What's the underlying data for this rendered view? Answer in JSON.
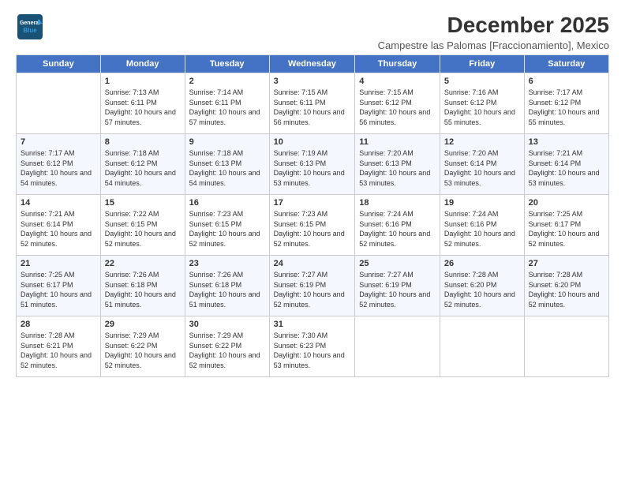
{
  "logo": {
    "line1": "General",
    "line2": "Blue"
  },
  "title": "December 2025",
  "location": "Campestre las Palomas [Fraccionamiento], Mexico",
  "days_of_week": [
    "Sunday",
    "Monday",
    "Tuesday",
    "Wednesday",
    "Thursday",
    "Friday",
    "Saturday"
  ],
  "weeks": [
    [
      {
        "day": "",
        "sunrise": "",
        "sunset": "",
        "daylight": ""
      },
      {
        "day": "1",
        "sunrise": "Sunrise: 7:13 AM",
        "sunset": "Sunset: 6:11 PM",
        "daylight": "Daylight: 10 hours and 57 minutes."
      },
      {
        "day": "2",
        "sunrise": "Sunrise: 7:14 AM",
        "sunset": "Sunset: 6:11 PM",
        "daylight": "Daylight: 10 hours and 57 minutes."
      },
      {
        "day": "3",
        "sunrise": "Sunrise: 7:15 AM",
        "sunset": "Sunset: 6:11 PM",
        "daylight": "Daylight: 10 hours and 56 minutes."
      },
      {
        "day": "4",
        "sunrise": "Sunrise: 7:15 AM",
        "sunset": "Sunset: 6:12 PM",
        "daylight": "Daylight: 10 hours and 56 minutes."
      },
      {
        "day": "5",
        "sunrise": "Sunrise: 7:16 AM",
        "sunset": "Sunset: 6:12 PM",
        "daylight": "Daylight: 10 hours and 55 minutes."
      },
      {
        "day": "6",
        "sunrise": "Sunrise: 7:17 AM",
        "sunset": "Sunset: 6:12 PM",
        "daylight": "Daylight: 10 hours and 55 minutes."
      }
    ],
    [
      {
        "day": "7",
        "sunrise": "Sunrise: 7:17 AM",
        "sunset": "Sunset: 6:12 PM",
        "daylight": "Daylight: 10 hours and 54 minutes."
      },
      {
        "day": "8",
        "sunrise": "Sunrise: 7:18 AM",
        "sunset": "Sunset: 6:12 PM",
        "daylight": "Daylight: 10 hours and 54 minutes."
      },
      {
        "day": "9",
        "sunrise": "Sunrise: 7:18 AM",
        "sunset": "Sunset: 6:13 PM",
        "daylight": "Daylight: 10 hours and 54 minutes."
      },
      {
        "day": "10",
        "sunrise": "Sunrise: 7:19 AM",
        "sunset": "Sunset: 6:13 PM",
        "daylight": "Daylight: 10 hours and 53 minutes."
      },
      {
        "day": "11",
        "sunrise": "Sunrise: 7:20 AM",
        "sunset": "Sunset: 6:13 PM",
        "daylight": "Daylight: 10 hours and 53 minutes."
      },
      {
        "day": "12",
        "sunrise": "Sunrise: 7:20 AM",
        "sunset": "Sunset: 6:14 PM",
        "daylight": "Daylight: 10 hours and 53 minutes."
      },
      {
        "day": "13",
        "sunrise": "Sunrise: 7:21 AM",
        "sunset": "Sunset: 6:14 PM",
        "daylight": "Daylight: 10 hours and 53 minutes."
      }
    ],
    [
      {
        "day": "14",
        "sunrise": "Sunrise: 7:21 AM",
        "sunset": "Sunset: 6:14 PM",
        "daylight": "Daylight: 10 hours and 52 minutes."
      },
      {
        "day": "15",
        "sunrise": "Sunrise: 7:22 AM",
        "sunset": "Sunset: 6:15 PM",
        "daylight": "Daylight: 10 hours and 52 minutes."
      },
      {
        "day": "16",
        "sunrise": "Sunrise: 7:23 AM",
        "sunset": "Sunset: 6:15 PM",
        "daylight": "Daylight: 10 hours and 52 minutes."
      },
      {
        "day": "17",
        "sunrise": "Sunrise: 7:23 AM",
        "sunset": "Sunset: 6:15 PM",
        "daylight": "Daylight: 10 hours and 52 minutes."
      },
      {
        "day": "18",
        "sunrise": "Sunrise: 7:24 AM",
        "sunset": "Sunset: 6:16 PM",
        "daylight": "Daylight: 10 hours and 52 minutes."
      },
      {
        "day": "19",
        "sunrise": "Sunrise: 7:24 AM",
        "sunset": "Sunset: 6:16 PM",
        "daylight": "Daylight: 10 hours and 52 minutes."
      },
      {
        "day": "20",
        "sunrise": "Sunrise: 7:25 AM",
        "sunset": "Sunset: 6:17 PM",
        "daylight": "Daylight: 10 hours and 52 minutes."
      }
    ],
    [
      {
        "day": "21",
        "sunrise": "Sunrise: 7:25 AM",
        "sunset": "Sunset: 6:17 PM",
        "daylight": "Daylight: 10 hours and 51 minutes."
      },
      {
        "day": "22",
        "sunrise": "Sunrise: 7:26 AM",
        "sunset": "Sunset: 6:18 PM",
        "daylight": "Daylight: 10 hours and 51 minutes."
      },
      {
        "day": "23",
        "sunrise": "Sunrise: 7:26 AM",
        "sunset": "Sunset: 6:18 PM",
        "daylight": "Daylight: 10 hours and 51 minutes."
      },
      {
        "day": "24",
        "sunrise": "Sunrise: 7:27 AM",
        "sunset": "Sunset: 6:19 PM",
        "daylight": "Daylight: 10 hours and 52 minutes."
      },
      {
        "day": "25",
        "sunrise": "Sunrise: 7:27 AM",
        "sunset": "Sunset: 6:19 PM",
        "daylight": "Daylight: 10 hours and 52 minutes."
      },
      {
        "day": "26",
        "sunrise": "Sunrise: 7:28 AM",
        "sunset": "Sunset: 6:20 PM",
        "daylight": "Daylight: 10 hours and 52 minutes."
      },
      {
        "day": "27",
        "sunrise": "Sunrise: 7:28 AM",
        "sunset": "Sunset: 6:20 PM",
        "daylight": "Daylight: 10 hours and 52 minutes."
      }
    ],
    [
      {
        "day": "28",
        "sunrise": "Sunrise: 7:28 AM",
        "sunset": "Sunset: 6:21 PM",
        "daylight": "Daylight: 10 hours and 52 minutes."
      },
      {
        "day": "29",
        "sunrise": "Sunrise: 7:29 AM",
        "sunset": "Sunset: 6:22 PM",
        "daylight": "Daylight: 10 hours and 52 minutes."
      },
      {
        "day": "30",
        "sunrise": "Sunrise: 7:29 AM",
        "sunset": "Sunset: 6:22 PM",
        "daylight": "Daylight: 10 hours and 52 minutes."
      },
      {
        "day": "31",
        "sunrise": "Sunrise: 7:30 AM",
        "sunset": "Sunset: 6:23 PM",
        "daylight": "Daylight: 10 hours and 53 minutes."
      },
      {
        "day": "",
        "sunrise": "",
        "sunset": "",
        "daylight": ""
      },
      {
        "day": "",
        "sunrise": "",
        "sunset": "",
        "daylight": ""
      },
      {
        "day": "",
        "sunrise": "",
        "sunset": "",
        "daylight": ""
      }
    ]
  ]
}
